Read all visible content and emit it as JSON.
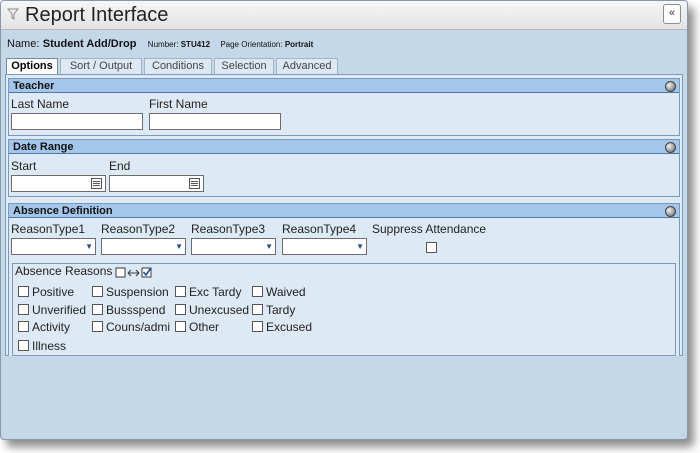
{
  "window": {
    "title": "Report Interface",
    "collapse_glyph": "«"
  },
  "icons": {
    "title_icon": "funnel-icon",
    "collapse": "chevron-left-icon",
    "calendar": "calendar-icon",
    "section_toggle": "circle-toggle-icon",
    "select_all": "select-all-icon"
  },
  "info": {
    "name_label": "Name:",
    "name_value": "Student Add/Drop",
    "number_label": "Number:",
    "number_value": "STU412",
    "orientation_label": "Page Orientation:",
    "orientation_value": "Portrait"
  },
  "tabs": [
    "Options",
    "Sort / Output",
    "Conditions",
    "Selection",
    "Advanced"
  ],
  "active_tab": "Options",
  "teacher": {
    "title": "Teacher",
    "last_name_label": "Last Name",
    "first_name_label": "First Name",
    "last_name_value": "",
    "first_name_value": ""
  },
  "date_range": {
    "title": "Date Range",
    "start_label": "Start",
    "end_label": "End",
    "start_value": "",
    "end_value": ""
  },
  "absence": {
    "title": "Absence Definition",
    "reason_type_labels": [
      "ReasonType1",
      "ReasonType2",
      "ReasonType3",
      "ReasonType4"
    ],
    "reason_type_values": [
      "",
      "",
      "",
      ""
    ],
    "suppress_label": "Suppress Attendance",
    "suppress_checked": false,
    "reasons_label": "Absence Reasons",
    "reasons": [
      [
        "Positive",
        "Suspension",
        "Exc Tardy",
        "Waived"
      ],
      [
        "Unverified",
        "Bussspend",
        "Unexcused",
        "Tardy"
      ],
      [
        "Activity",
        "Couns/admi",
        "Other",
        "Excused"
      ],
      [
        "Illness"
      ]
    ]
  },
  "colors": {
    "window_bg": "#c5d8ea",
    "section_header": "#a3c6ea",
    "panel_bg": "#dde9f4",
    "border": "#7c99b8"
  }
}
